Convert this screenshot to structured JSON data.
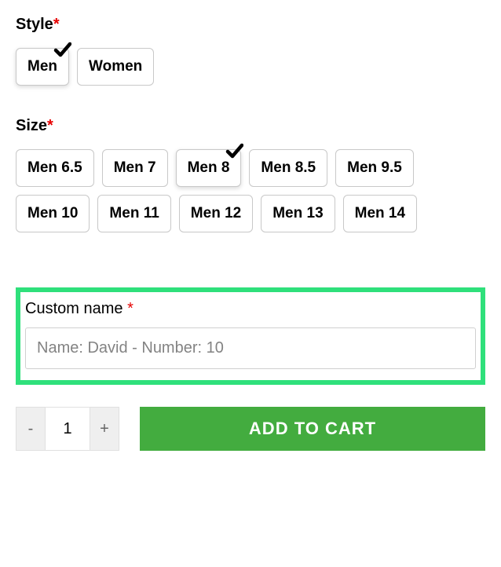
{
  "style": {
    "label": "Style",
    "options": [
      {
        "label": "Men",
        "selected": true
      },
      {
        "label": "Women",
        "selected": false
      }
    ]
  },
  "size": {
    "label": "Size",
    "options": [
      {
        "label": "Men 6.5",
        "selected": false
      },
      {
        "label": "Men 7",
        "selected": false
      },
      {
        "label": "Men 8",
        "selected": true
      },
      {
        "label": "Men 8.5",
        "selected": false
      },
      {
        "label": "Men 9.5",
        "selected": false
      },
      {
        "label": "Men 10",
        "selected": false
      },
      {
        "label": "Men 11",
        "selected": false
      },
      {
        "label": "Men 12",
        "selected": false
      },
      {
        "label": "Men 13",
        "selected": false
      },
      {
        "label": "Men 14",
        "selected": false
      }
    ]
  },
  "custom_name": {
    "label": "Custom name ",
    "placeholder": "Name: David - Number: 10",
    "value": ""
  },
  "quantity": {
    "minus": "-",
    "plus": "+",
    "value": "1"
  },
  "add_to_cart_label": "ADD TO CART",
  "required_marker": "*"
}
